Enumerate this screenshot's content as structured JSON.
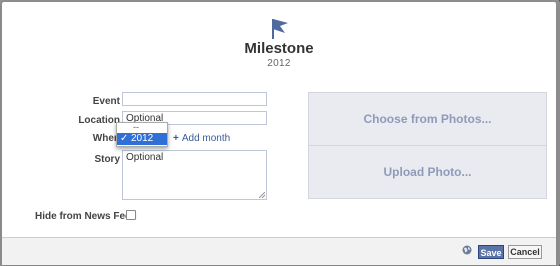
{
  "background": {
    "hint_text": "······ ········ ·······"
  },
  "dialog": {
    "title": "Milestone",
    "year": "2012",
    "icon": "flag-icon",
    "accent_color": "#4f6a9e"
  },
  "form": {
    "event": {
      "label": "Event",
      "value": "",
      "placeholder": ""
    },
    "location": {
      "label": "Location",
      "value": "",
      "placeholder": "Optional"
    },
    "when": {
      "label": "When",
      "dropdown_options": [
        "--",
        "2012"
      ],
      "selected": "2012",
      "add_month": "Add month"
    },
    "story": {
      "label": "Story",
      "value": "",
      "placeholder": "Optional"
    },
    "hide_from_feed": {
      "label": "Hide from News Feed",
      "checked": false
    }
  },
  "photos": {
    "choose": "Choose from Photos...",
    "upload": "Upload Photo..."
  },
  "footer": {
    "privacy_icon": "globe-icon",
    "save": "Save",
    "cancel": "Cancel",
    "save_color": "#5b74a8"
  }
}
